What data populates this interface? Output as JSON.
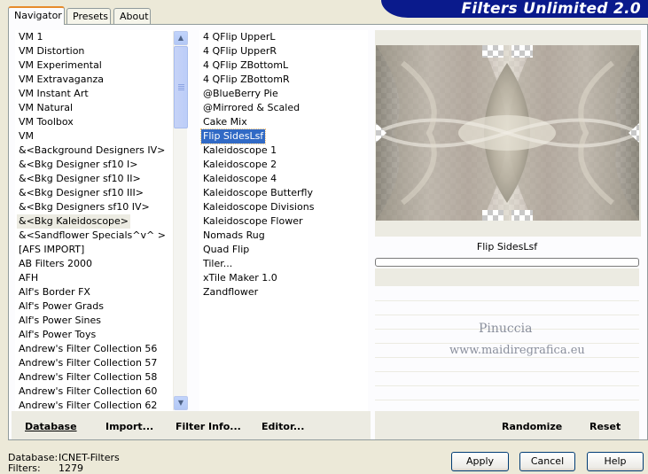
{
  "app": {
    "title": "Filters Unlimited 2.0"
  },
  "tabs": [
    {
      "label": "Navigator"
    },
    {
      "label": "Presets"
    },
    {
      "label": "About"
    }
  ],
  "categories": [
    "VM 1",
    "VM Distortion",
    "VM Experimental",
    "VM Extravaganza",
    "VM Instant Art",
    "VM Natural",
    "VM Toolbox",
    "VM",
    "&<Background Designers IV>",
    "&<Bkg Designer sf10 I>",
    "&<Bkg Designer sf10 II>",
    "&<Bkg Designer sf10 III>",
    "&<Bkg Designers sf10 IV>",
    "&<Bkg Kaleidoscope>",
    "&<Sandflower Specials^v^ >",
    "[AFS IMPORT]",
    "AB Filters 2000",
    "AFH",
    "Alf's Border FX",
    "Alf's Power Grads",
    "Alf's Power Sines",
    "Alf's Power Toys",
    "Andrew's Filter Collection 56",
    "Andrew's Filter Collection 57",
    "Andrew's Filter Collection 58",
    "Andrew's Filter Collection 60",
    "Andrew's Filter Collection 62"
  ],
  "selected_category": "&<Bkg Kaleidoscope>",
  "filters": [
    "4 QFlip UpperL",
    "4 QFlip UpperR",
    "4 QFlip ZBottomL",
    "4 QFlip ZBottomR",
    "@BlueBerry Pie",
    "@Mirrored & Scaled",
    "Cake Mix",
    "Flip SidesLsf",
    "Kaleidoscope 1",
    "Kaleidoscope 2",
    "Kaleidoscope 4",
    "Kaleidoscope Butterfly",
    "Kaleidoscope Divisions",
    "Kaleidoscope Flower",
    "Nomads Rug",
    "Quad Flip",
    "Tiler...",
    "xTile Maker 1.0",
    "Zandflower"
  ],
  "selected_filter": "Flip SidesLsf",
  "preview": {
    "filter_name": "Flip SidesLsf",
    "progress": 0
  },
  "watermark": {
    "line1": "Pinuccia",
    "line2": "www.maidiregrafica.eu"
  },
  "toolbar": {
    "database": "Database",
    "import": "Import...",
    "filter_info": "Filter Info...",
    "editor": "Editor...",
    "randomize": "Randomize",
    "reset": "Reset"
  },
  "status": {
    "database_label": "Database:",
    "database_value": "ICNET-Filters",
    "filters_label": "Filters:",
    "filters_value": "1279"
  },
  "buttons": {
    "apply": "Apply",
    "cancel": "Cancel",
    "help": "Help"
  },
  "icons": {
    "scroll_up": "chevron-up-icon",
    "scroll_down": "chevron-down-icon"
  }
}
